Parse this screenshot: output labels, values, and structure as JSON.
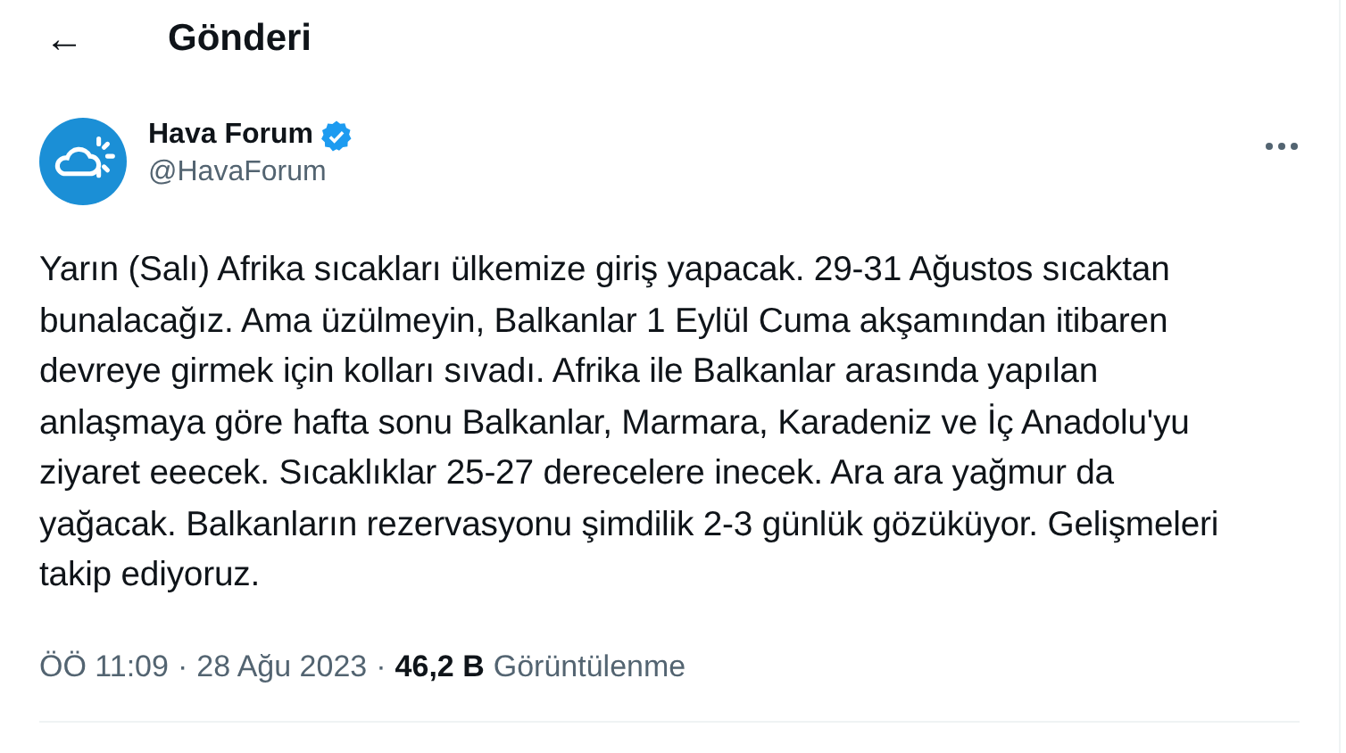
{
  "header": {
    "back_icon": "←",
    "title": "Gönderi"
  },
  "post": {
    "author": {
      "name": "Hava Forum",
      "verified": true,
      "handle": "@HavaForum"
    },
    "text": "Yarın (Salı) Afrika sıcakları ülkemize giriş yapacak. 29-31 Ağustos sıcaktan bunalacağız. Ama üzülmeyin, Balkanlar 1 Eylül Cuma akşamından itibaren devreye girmek için kolları sıvadı. Afrika ile Balkanlar arasında yapılan anlaşmaya göre hafta sonu Balkanlar, Marmara, Karadeniz ve İç Anadolu'yu ziyaret eeecek. Sıcaklıklar 25-27 derecelere inecek. Ara ara yağmur da yağacak. Balkanların rezervasyonu şimdilik 2-3 günlük gözüküyor. Gelişmeleri takip ediyoruz.",
    "time": "ÖÖ 11:09",
    "separator": "·",
    "date": "28 Ağu 2023",
    "views_count": "46,2 B",
    "views_label": "Görüntülenme"
  }
}
